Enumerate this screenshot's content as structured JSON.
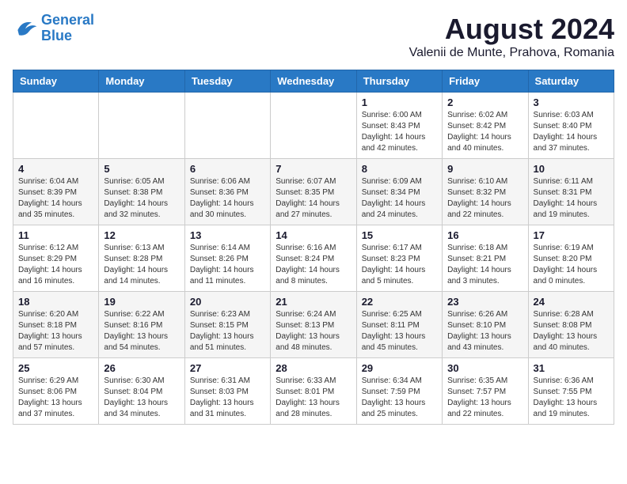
{
  "logo": {
    "line1": "General",
    "line2": "Blue"
  },
  "title": "August 2024",
  "location": "Valenii de Munte, Prahova, Romania",
  "days_of_week": [
    "Sunday",
    "Monday",
    "Tuesday",
    "Wednesday",
    "Thursday",
    "Friday",
    "Saturday"
  ],
  "weeks": [
    [
      {
        "day": "",
        "info": ""
      },
      {
        "day": "",
        "info": ""
      },
      {
        "day": "",
        "info": ""
      },
      {
        "day": "",
        "info": ""
      },
      {
        "day": "1",
        "info": "Sunrise: 6:00 AM\nSunset: 8:43 PM\nDaylight: 14 hours\nand 42 minutes."
      },
      {
        "day": "2",
        "info": "Sunrise: 6:02 AM\nSunset: 8:42 PM\nDaylight: 14 hours\nand 40 minutes."
      },
      {
        "day": "3",
        "info": "Sunrise: 6:03 AM\nSunset: 8:40 PM\nDaylight: 14 hours\nand 37 minutes."
      }
    ],
    [
      {
        "day": "4",
        "info": "Sunrise: 6:04 AM\nSunset: 8:39 PM\nDaylight: 14 hours\nand 35 minutes."
      },
      {
        "day": "5",
        "info": "Sunrise: 6:05 AM\nSunset: 8:38 PM\nDaylight: 14 hours\nand 32 minutes."
      },
      {
        "day": "6",
        "info": "Sunrise: 6:06 AM\nSunset: 8:36 PM\nDaylight: 14 hours\nand 30 minutes."
      },
      {
        "day": "7",
        "info": "Sunrise: 6:07 AM\nSunset: 8:35 PM\nDaylight: 14 hours\nand 27 minutes."
      },
      {
        "day": "8",
        "info": "Sunrise: 6:09 AM\nSunset: 8:34 PM\nDaylight: 14 hours\nand 24 minutes."
      },
      {
        "day": "9",
        "info": "Sunrise: 6:10 AM\nSunset: 8:32 PM\nDaylight: 14 hours\nand 22 minutes."
      },
      {
        "day": "10",
        "info": "Sunrise: 6:11 AM\nSunset: 8:31 PM\nDaylight: 14 hours\nand 19 minutes."
      }
    ],
    [
      {
        "day": "11",
        "info": "Sunrise: 6:12 AM\nSunset: 8:29 PM\nDaylight: 14 hours\nand 16 minutes."
      },
      {
        "day": "12",
        "info": "Sunrise: 6:13 AM\nSunset: 8:28 PM\nDaylight: 14 hours\nand 14 minutes."
      },
      {
        "day": "13",
        "info": "Sunrise: 6:14 AM\nSunset: 8:26 PM\nDaylight: 14 hours\nand 11 minutes."
      },
      {
        "day": "14",
        "info": "Sunrise: 6:16 AM\nSunset: 8:24 PM\nDaylight: 14 hours\nand 8 minutes."
      },
      {
        "day": "15",
        "info": "Sunrise: 6:17 AM\nSunset: 8:23 PM\nDaylight: 14 hours\nand 5 minutes."
      },
      {
        "day": "16",
        "info": "Sunrise: 6:18 AM\nSunset: 8:21 PM\nDaylight: 14 hours\nand 3 minutes."
      },
      {
        "day": "17",
        "info": "Sunrise: 6:19 AM\nSunset: 8:20 PM\nDaylight: 14 hours\nand 0 minutes."
      }
    ],
    [
      {
        "day": "18",
        "info": "Sunrise: 6:20 AM\nSunset: 8:18 PM\nDaylight: 13 hours\nand 57 minutes."
      },
      {
        "day": "19",
        "info": "Sunrise: 6:22 AM\nSunset: 8:16 PM\nDaylight: 13 hours\nand 54 minutes."
      },
      {
        "day": "20",
        "info": "Sunrise: 6:23 AM\nSunset: 8:15 PM\nDaylight: 13 hours\nand 51 minutes."
      },
      {
        "day": "21",
        "info": "Sunrise: 6:24 AM\nSunset: 8:13 PM\nDaylight: 13 hours\nand 48 minutes."
      },
      {
        "day": "22",
        "info": "Sunrise: 6:25 AM\nSunset: 8:11 PM\nDaylight: 13 hours\nand 45 minutes."
      },
      {
        "day": "23",
        "info": "Sunrise: 6:26 AM\nSunset: 8:10 PM\nDaylight: 13 hours\nand 43 minutes."
      },
      {
        "day": "24",
        "info": "Sunrise: 6:28 AM\nSunset: 8:08 PM\nDaylight: 13 hours\nand 40 minutes."
      }
    ],
    [
      {
        "day": "25",
        "info": "Sunrise: 6:29 AM\nSunset: 8:06 PM\nDaylight: 13 hours\nand 37 minutes."
      },
      {
        "day": "26",
        "info": "Sunrise: 6:30 AM\nSunset: 8:04 PM\nDaylight: 13 hours\nand 34 minutes."
      },
      {
        "day": "27",
        "info": "Sunrise: 6:31 AM\nSunset: 8:03 PM\nDaylight: 13 hours\nand 31 minutes."
      },
      {
        "day": "28",
        "info": "Sunrise: 6:33 AM\nSunset: 8:01 PM\nDaylight: 13 hours\nand 28 minutes."
      },
      {
        "day": "29",
        "info": "Sunrise: 6:34 AM\nSunset: 7:59 PM\nDaylight: 13 hours\nand 25 minutes."
      },
      {
        "day": "30",
        "info": "Sunrise: 6:35 AM\nSunset: 7:57 PM\nDaylight: 13 hours\nand 22 minutes."
      },
      {
        "day": "31",
        "info": "Sunrise: 6:36 AM\nSunset: 7:55 PM\nDaylight: 13 hours\nand 19 minutes."
      }
    ]
  ]
}
